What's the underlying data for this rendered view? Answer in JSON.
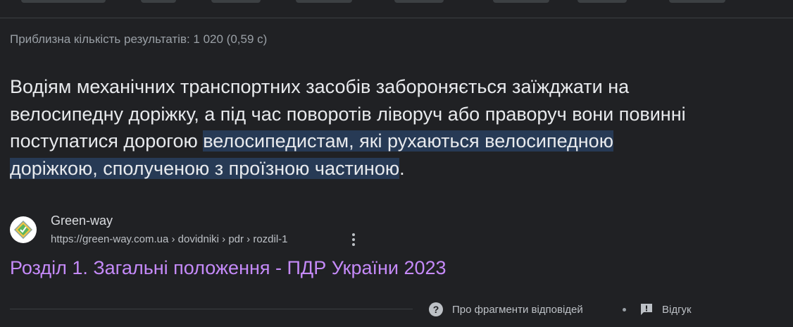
{
  "result_stats": "Приблизна кількість результатів: 1 020 (0,59 с)",
  "snippet": {
    "text_plain": "Водіям механічних транспортних засобів забороняється заїжджати на велосипедну доріжку, а під час поворотів ліворуч або праворуч вони повинні поступатися дорогою ",
    "text_highlight": "велосипедистам, які рухаються велосипедною доріжкою, сполученою з проїзною частиною",
    "text_end": ".",
    "highlight_color": "#273a55"
  },
  "source": {
    "site_name": "Green-way",
    "url": "https://green-way.com.ua › dovidniki › pdr › rozdil-1",
    "favicon_icon": "green-way-logo-icon",
    "more_icon": "more-vert-icon"
  },
  "result": {
    "title": "Розділ 1. Загальні положення - ПДР України 2023",
    "title_color": "#c58af9"
  },
  "footer": {
    "help_label": "Про фрагменти відповідей",
    "help_icon": "help-icon",
    "feedback_label": "Відгук",
    "feedback_icon": "feedback-icon"
  }
}
